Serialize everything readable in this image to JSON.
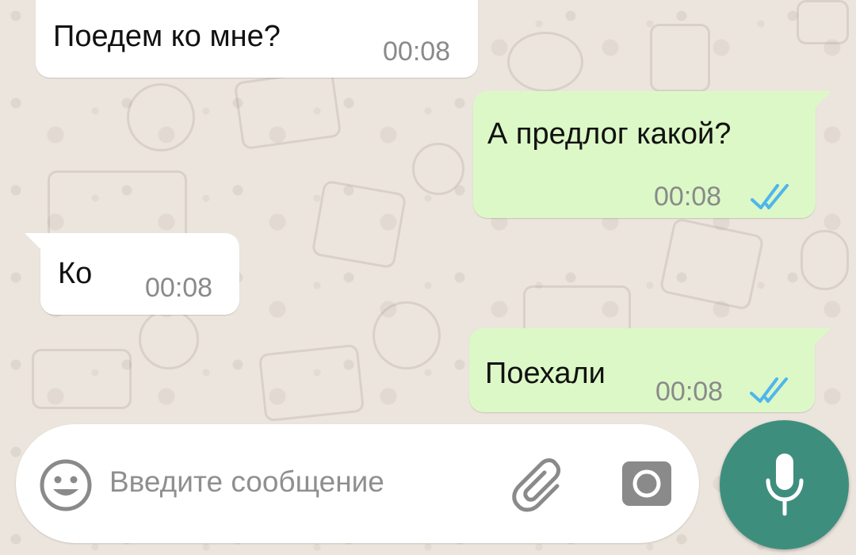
{
  "colors": {
    "wallpaper": "#ece5dd",
    "incoming_bubble": "#ffffff",
    "outgoing_bubble": "#dcf8c6",
    "read_ticks": "#4fb6ec",
    "mic_button": "#3e8e7e",
    "icon_gray": "#8a8a8a"
  },
  "messages": [
    {
      "direction": "incoming",
      "text": "Поедем ко мне?",
      "time": "00:08"
    },
    {
      "direction": "outgoing",
      "text": "А предлог какой?",
      "time": "00:08",
      "status": "read"
    },
    {
      "direction": "incoming",
      "text": "Ко",
      "time": "00:08"
    },
    {
      "direction": "outgoing",
      "text": "Поехали",
      "time": "00:08",
      "status": "read"
    }
  ],
  "composer": {
    "placeholder": "Введите сообщение",
    "icons": [
      "emoji-icon",
      "paperclip-icon",
      "camera-icon",
      "microphone-icon"
    ]
  }
}
